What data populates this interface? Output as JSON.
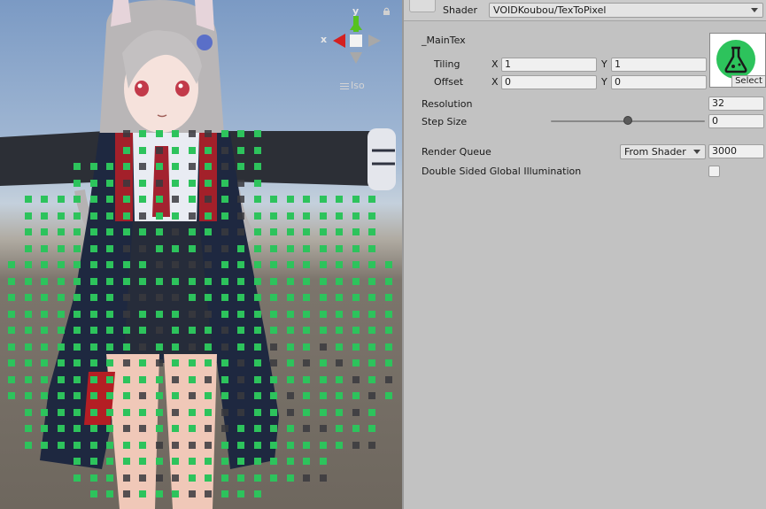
{
  "scene": {
    "gizmo": {
      "y_label": "y",
      "x_label": "x",
      "projection": "Iso"
    }
  },
  "inspector": {
    "shader": {
      "label": "Shader",
      "value": "VOIDKoubou/TexToPixel"
    },
    "main_tex": {
      "label": "_MainTex",
      "tiling": {
        "label": "Tiling",
        "x_axis": "X",
        "y_axis": "Y",
        "x": "1",
        "y": "1"
      },
      "offset": {
        "label": "Offset",
        "x_axis": "X",
        "y_axis": "Y",
        "x": "0",
        "y": "0"
      },
      "select_label": "Select",
      "icon": "flask-icon"
    },
    "resolution": {
      "label": "Resolution",
      "value": "32"
    },
    "step_size": {
      "label": "Step Size",
      "value": "0",
      "slider_level": 0.5
    },
    "render_queue": {
      "label": "Render Queue",
      "mode": "From Shader",
      "value": "3000"
    },
    "double_sided_gi": {
      "label": "Double Sided Global Illumination",
      "checked": false
    }
  },
  "colors": {
    "pixel_green": "#2dc35c",
    "pixel_dark": "#3a3a3e",
    "inspector_bg": "#c2c2c2",
    "gizmo_x": "#d42020",
    "gizmo_y": "#56c21e"
  }
}
